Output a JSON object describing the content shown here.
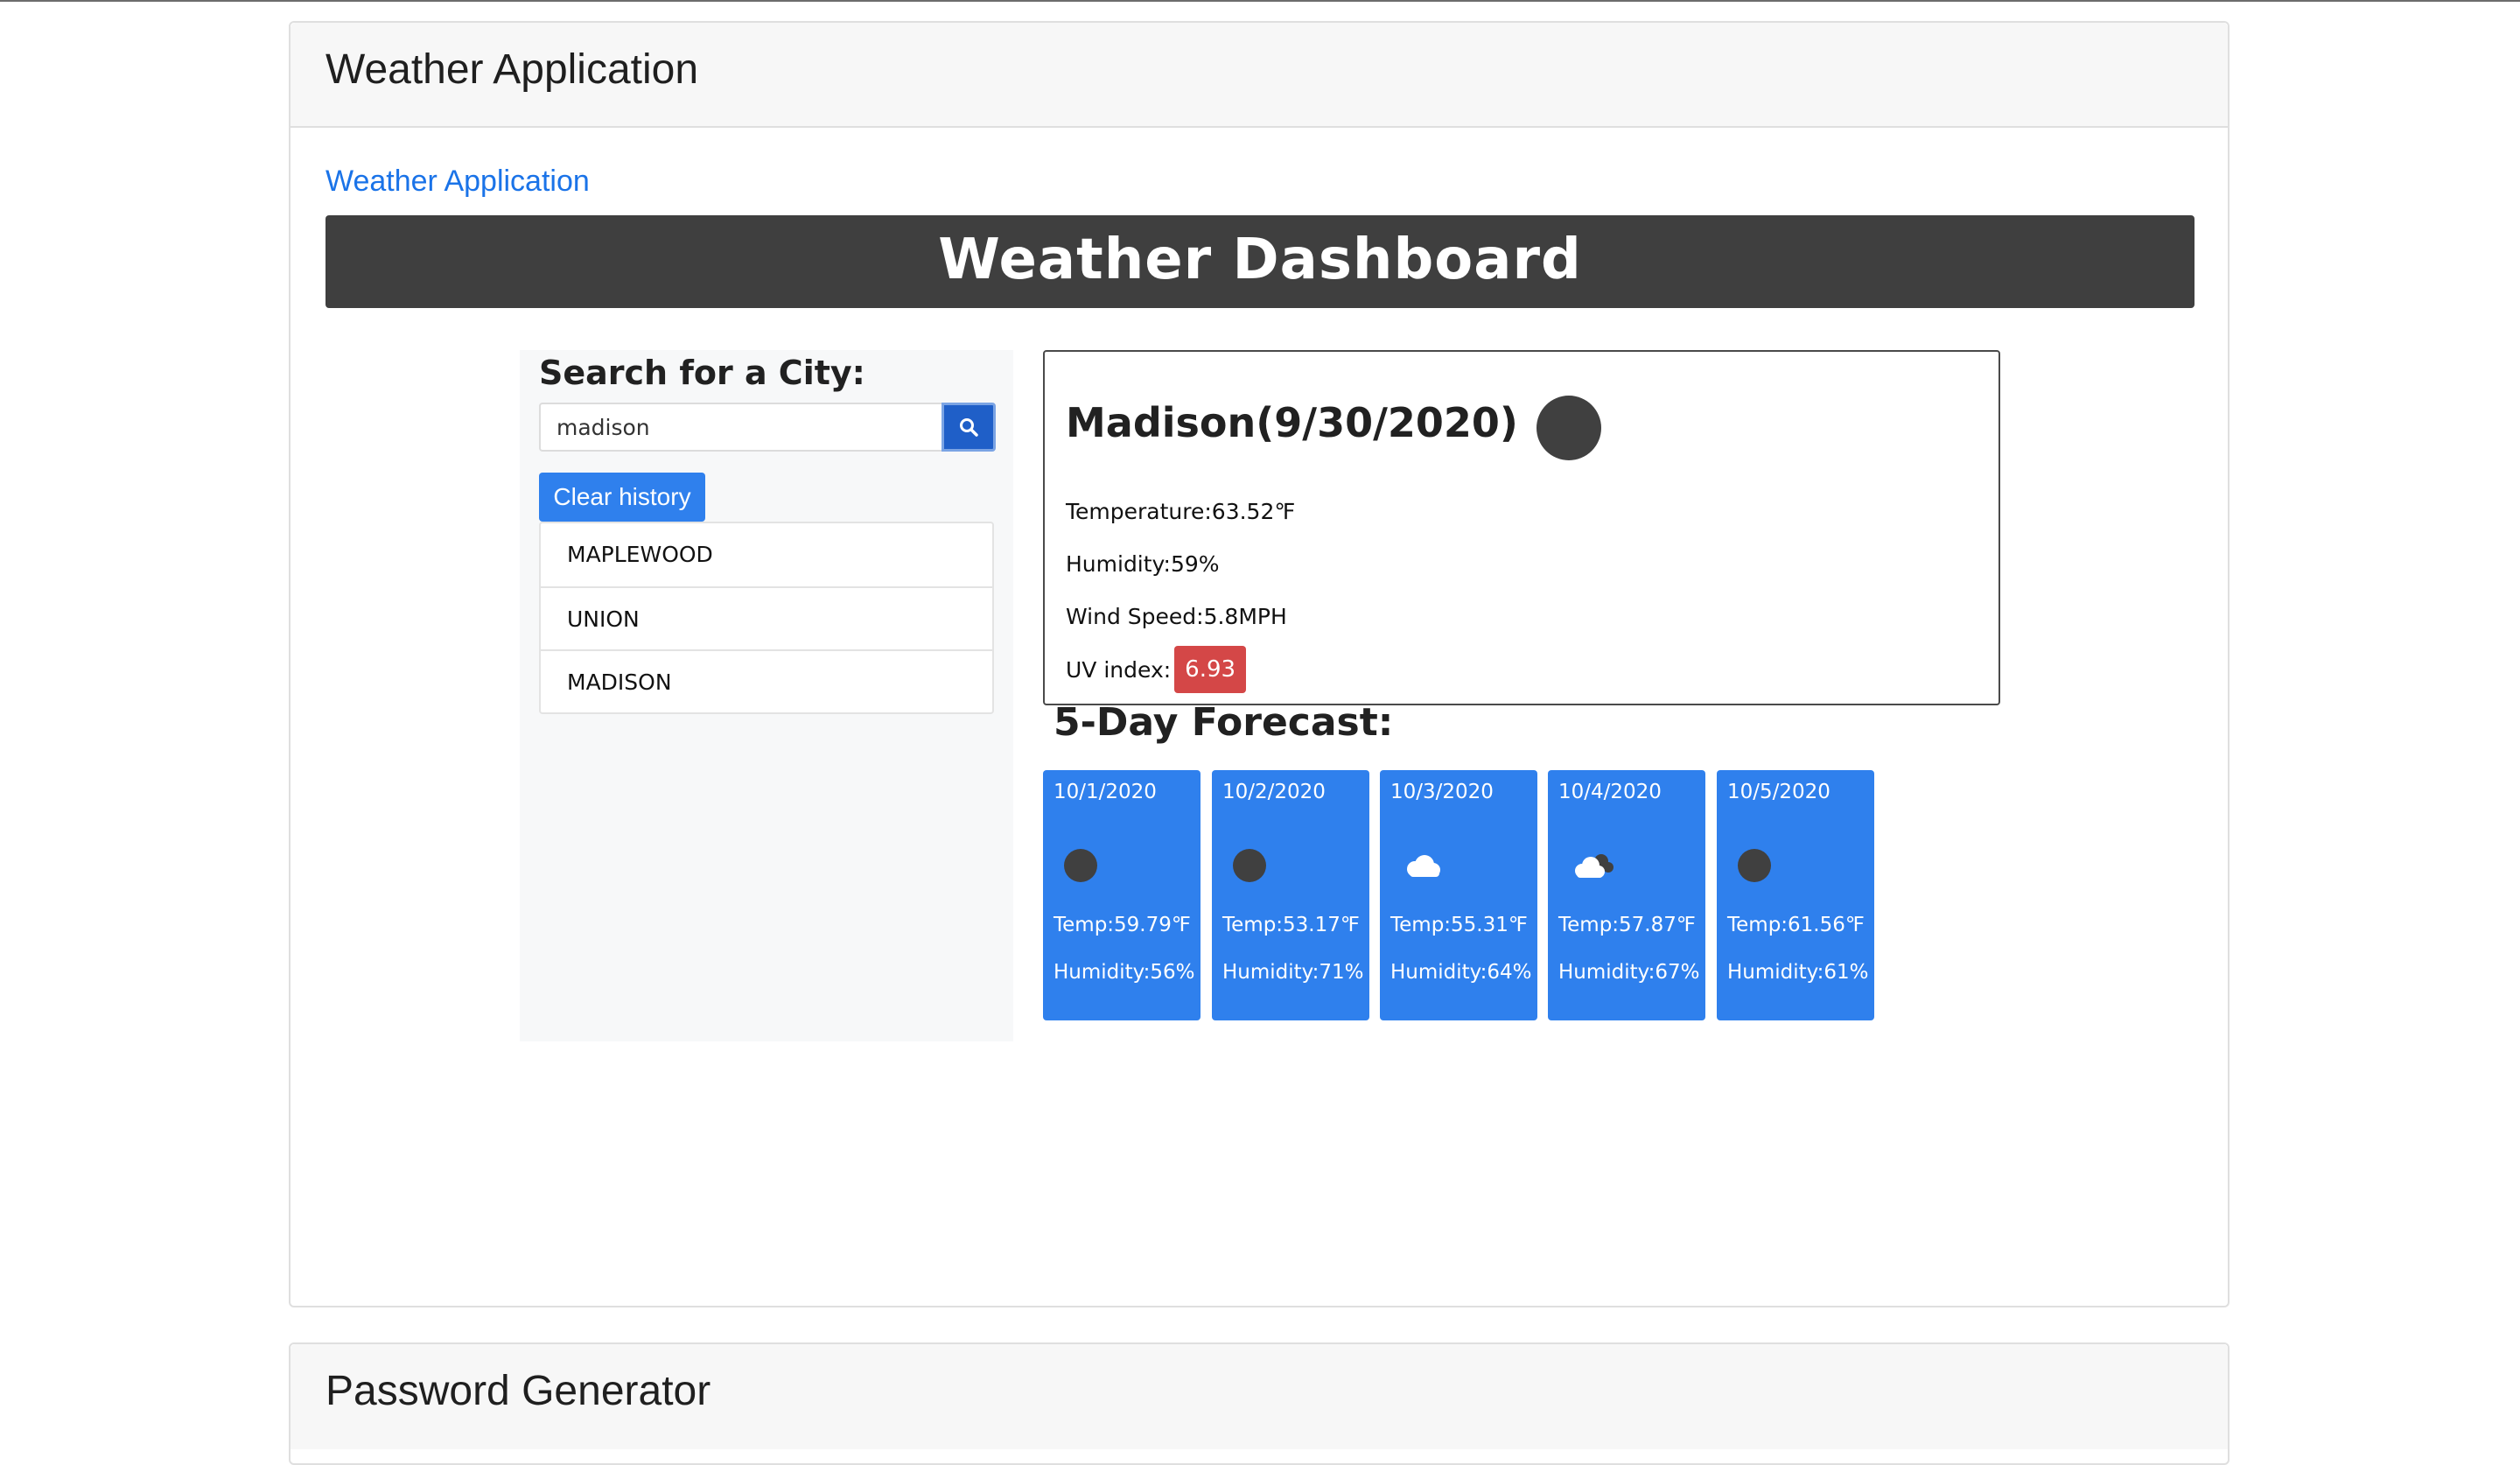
{
  "sections": {
    "weather_title": "Weather Application",
    "password_title": "Password Generator"
  },
  "app_link": "Weather Application",
  "banner": {
    "title": "Weather Dashboard"
  },
  "search": {
    "label": "Search for a City:",
    "value": "madison",
    "button_icon": "search-icon",
    "clear_label": "Clear history"
  },
  "history": [
    "MAPLEWOOD",
    "UNION",
    "MADISON"
  ],
  "current": {
    "city_date": "Madison(9/30/2020)",
    "icon": "weather-icon",
    "temperature": "Temperature:63.52℉",
    "humidity": "Humidity:59%",
    "wind": "Wind Speed:5.8MPH",
    "uv_label": "UV index:",
    "uv_value": "6.93"
  },
  "forecast": {
    "title": "5-Day Forecast:",
    "days": [
      {
        "date": "10/1/2020",
        "icon": "weather-icon",
        "temp": "Temp:59.79℉",
        "humidity": "Humidity:56%"
      },
      {
        "date": "10/2/2020",
        "icon": "weather-icon",
        "temp": "Temp:53.17℉",
        "humidity": "Humidity:71%"
      },
      {
        "date": "10/3/2020",
        "icon": "cloud-icon",
        "temp": "Temp:55.31℉",
        "humidity": "Humidity:64%"
      },
      {
        "date": "10/4/2020",
        "icon": "partly-cloudy-icon",
        "temp": "Temp:57.87℉",
        "humidity": "Humidity:67%"
      },
      {
        "date": "10/5/2020",
        "icon": "weather-icon",
        "temp": "Temp:61.56℉",
        "humidity": "Humidity:61%"
      }
    ]
  },
  "colors": {
    "banner": "#3f3f3f",
    "primary": "#2f80ed",
    "search_button": "#1f5fc8",
    "uv_badge": "#d44747",
    "link": "#1a73e8"
  }
}
